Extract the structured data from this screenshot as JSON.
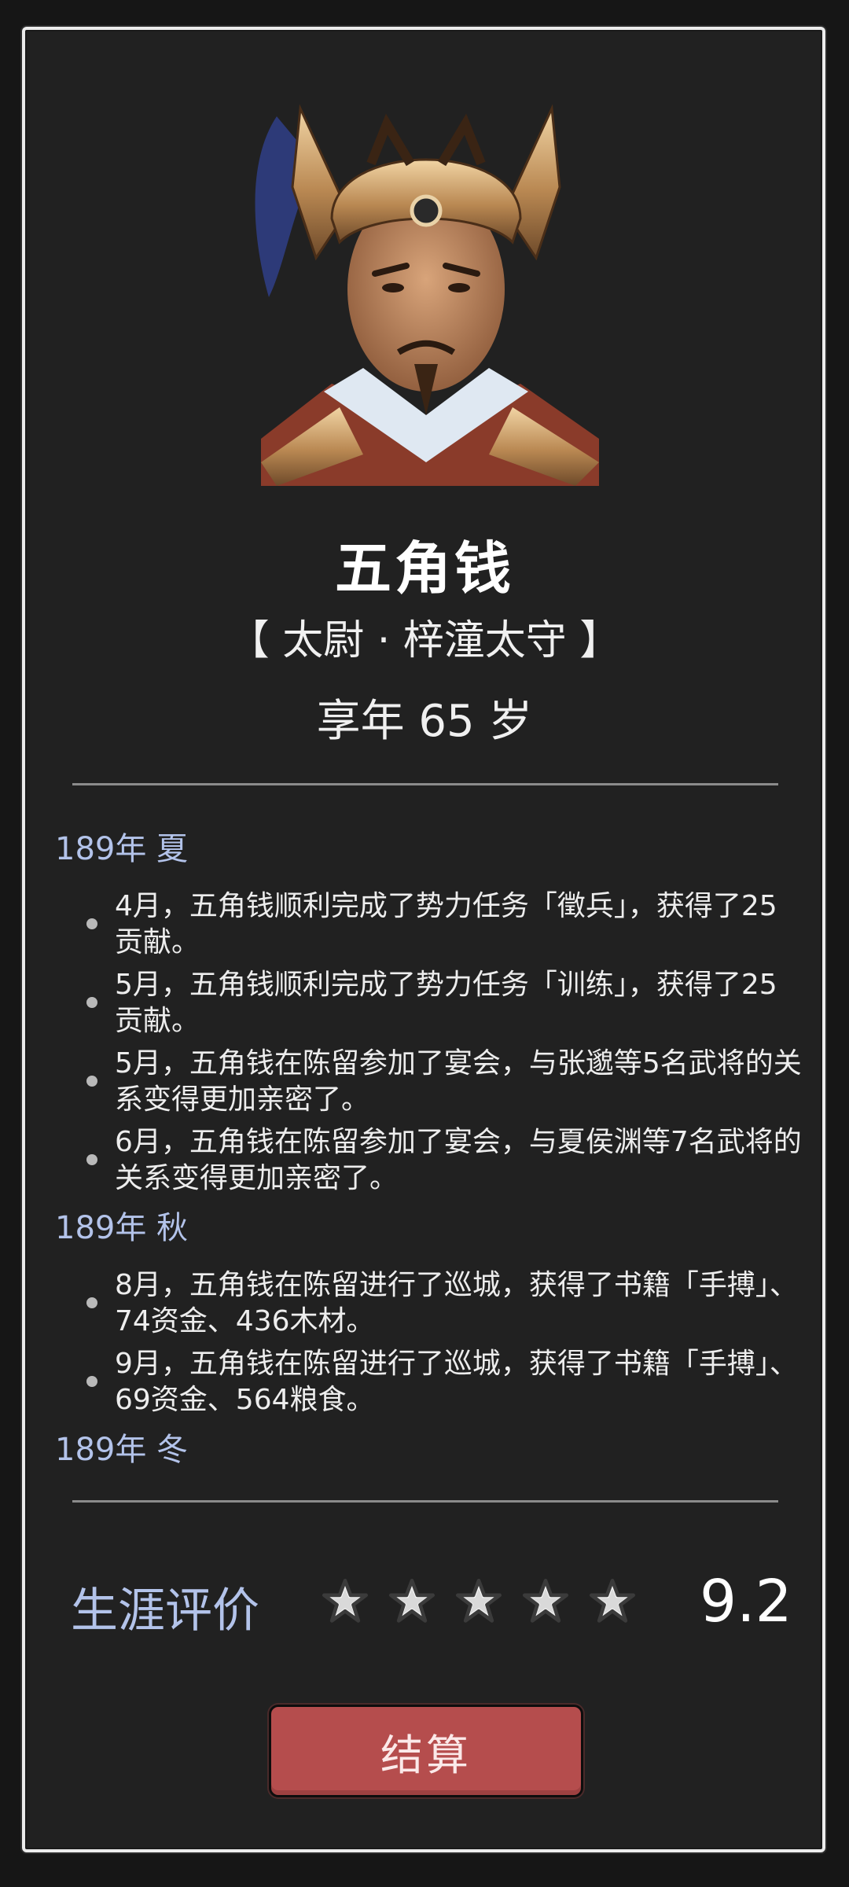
{
  "profile": {
    "name": "五角钱",
    "titles": "【 太尉 · 梓潼太守 】",
    "age": "享年 65 岁"
  },
  "log": [
    {
      "season": "189年 夏",
      "entries": [
        "4月，五角钱顺利完成了势力任务「徵兵」，获得了25贡献。",
        "5月，五角钱顺利完成了势力任务「训练」，获得了25贡献。",
        "5月，五角钱在陈留参加了宴会，与张邈等5名武将的关系变得更加亲密了。",
        "6月，五角钱在陈留参加了宴会，与夏侯渊等7名武将的关系变得更加亲密了。"
      ]
    },
    {
      "season": "189年 秋",
      "entries": [
        "8月，五角钱在陈留进行了巡城，获得了书籍「手搏」、74资金、436木材。",
        "9月，五角钱在陈留进行了巡城，获得了书籍「手搏」、69资金、564粮食。"
      ]
    },
    {
      "season": "189年 冬",
      "entries": []
    }
  ],
  "rating": {
    "label": "生涯评价",
    "stars_filled": 4.6,
    "stars_total": 5,
    "score": "9.2"
  },
  "actions": {
    "settle_label": "结算"
  },
  "colors": {
    "accent_blue": "#b3c3ea",
    "button_red": "#b54d4d",
    "background": "#212121"
  }
}
